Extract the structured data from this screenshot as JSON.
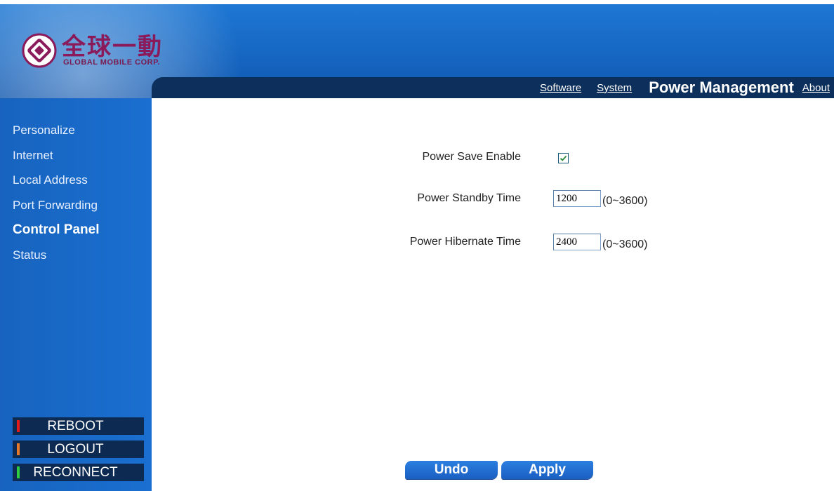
{
  "header": {
    "logo_cn": "全球一動",
    "logo_en": "GLOBAL MOBILE CORP."
  },
  "nav": {
    "links": [
      "Software",
      "System"
    ],
    "active": "Power Management",
    "about": "About"
  },
  "sidebar": {
    "items": [
      {
        "label": "Personalize"
      },
      {
        "label": "Internet"
      },
      {
        "label": "Local Address"
      },
      {
        "label": "Port Forwarding"
      },
      {
        "label": "Control Panel"
      },
      {
        "label": "Status"
      }
    ],
    "buttons": {
      "reboot": {
        "label": "REBOOT",
        "indicator_color": "#e31a1a"
      },
      "logout": {
        "label": "LOGOUT",
        "indicator_color": "#e8782a"
      },
      "reconnect": {
        "label": "RECONNECT",
        "indicator_color": "#2ecc40"
      }
    }
  },
  "form": {
    "power_save": {
      "label": "Power Save Enable",
      "checked": true
    },
    "standby": {
      "label": "Power Standby Time",
      "value": "1200",
      "range": "(0~3600)"
    },
    "hibernate": {
      "label": "Power Hibernate Time",
      "value": "2400",
      "range": "(0~3600)"
    }
  },
  "actions": {
    "undo": "Undo",
    "apply": "Apply"
  },
  "colors": {
    "header_blue": "#1565c0",
    "nav_navy": "#0d2f5c",
    "sidebar_blue": "#1a6fd0",
    "logo_magenta": "#8b1a5a"
  }
}
